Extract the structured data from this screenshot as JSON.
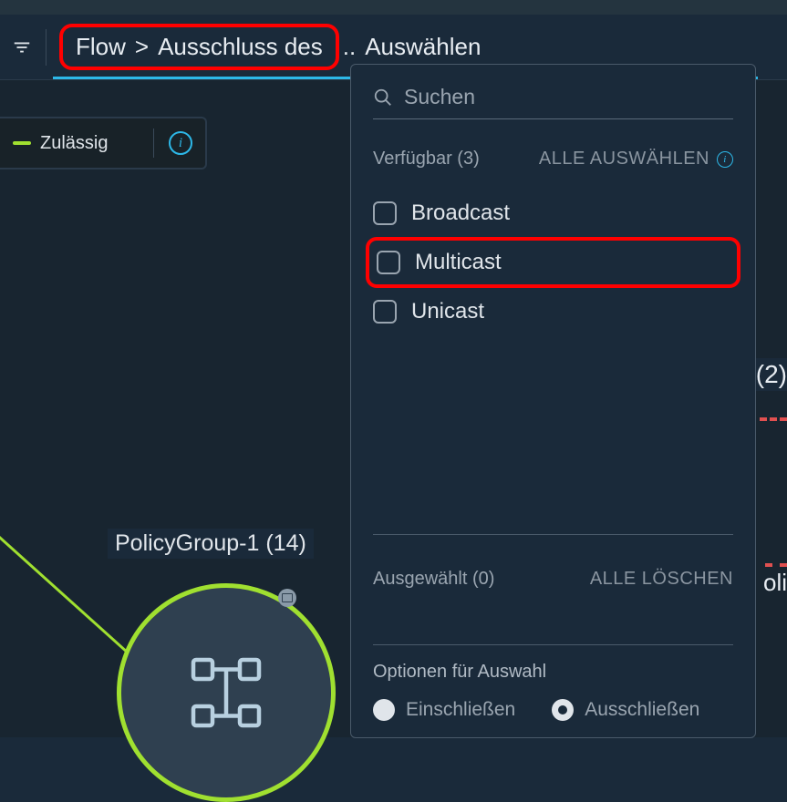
{
  "header": {
    "breadcrumb_part1": "Flow",
    "breadcrumb_sep": ">",
    "breadcrumb_part2": "Ausschluss des",
    "ellipsis": "..",
    "select_label": "Auswählen"
  },
  "legend": {
    "allowed": "Zulässig"
  },
  "graph": {
    "node1_label": "PolicyGroup-1 (14)",
    "right_count": "(2)",
    "right_partial": "oli"
  },
  "dropdown": {
    "search_placeholder": "Suchen",
    "available_label": "Verfügbar (3)",
    "select_all": "ALLE AUSWÄHLEN",
    "options": [
      {
        "label": "Broadcast",
        "highlighted": false
      },
      {
        "label": "Multicast",
        "highlighted": true
      },
      {
        "label": "Unicast",
        "highlighted": false
      }
    ],
    "selected_label": "Ausgewählt (0)",
    "clear_all": "ALLE LÖSCHEN",
    "options_title": "Optionen für Auswahl",
    "radio_include": "Einschließen",
    "radio_exclude": "Ausschließen",
    "radio_selected": "exclude"
  }
}
